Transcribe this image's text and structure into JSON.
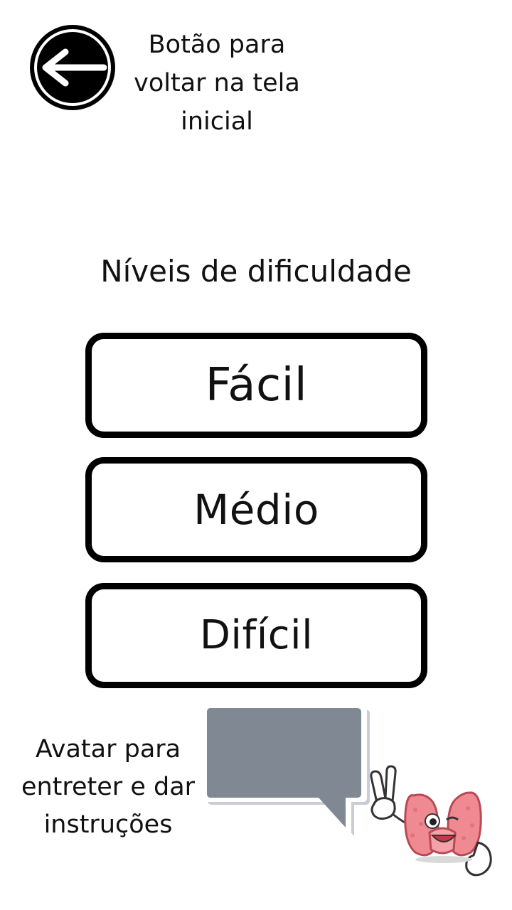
{
  "header": {
    "back_button_icon": "arrow-left-icon",
    "back_caption": "Botão para\nvoltar na tela\ninicial"
  },
  "main": {
    "title": "Níveis de dificuldade",
    "levels": [
      {
        "label": "Fácil"
      },
      {
        "label": "Médio"
      },
      {
        "label": "Difícil"
      }
    ]
  },
  "footer": {
    "avatar_caption": "Avatar para\nentreter e dar\ninstruções",
    "bubble_color": "#808893",
    "avatar_icon": "thyroid-mascot-icon"
  }
}
